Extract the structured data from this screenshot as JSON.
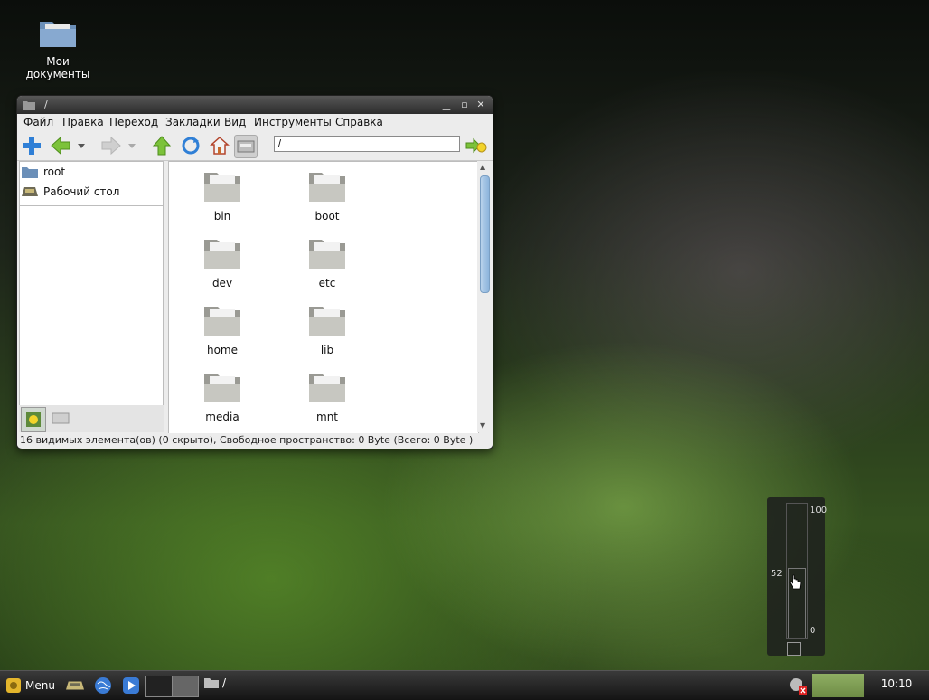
{
  "desktop": {
    "icons": [
      {
        "label": "Мои документы"
      }
    ]
  },
  "window": {
    "title": "/",
    "menu": [
      "Файл",
      "Правка",
      "Переход",
      "Закладки",
      "Вид",
      "Инструменты",
      "Справка"
    ],
    "address": "/",
    "sidebar": {
      "items": [
        {
          "label": "root"
        },
        {
          "label": "Рабочий стол"
        }
      ]
    },
    "files": [
      "bin",
      "boot",
      "dev",
      "etc",
      "home",
      "lib",
      "media",
      "mnt"
    ],
    "status": "16 видимых элемента(ов) (0 скрыто), Свободное пространство: 0 Byte (Всего: 0 Byte )"
  },
  "volume": {
    "max_label": "100",
    "min_label": "0",
    "value_label": "52",
    "level_percent": 52
  },
  "taskbar": {
    "menu_label": "Menu",
    "task_label": "/",
    "clock": "10:10"
  },
  "colors": {
    "accent": "#3a7bd5",
    "window_bg": "#ececec",
    "titlebar": "#3b3b3b"
  }
}
